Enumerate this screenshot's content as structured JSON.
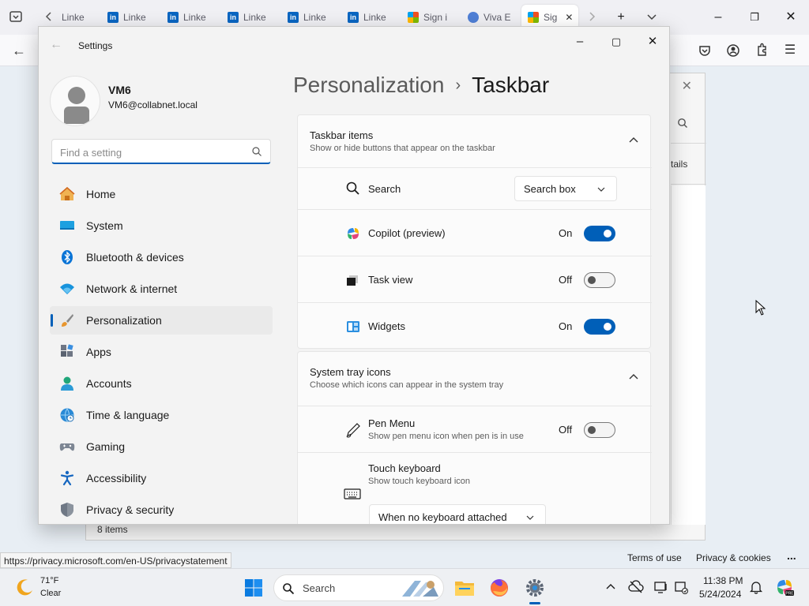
{
  "browser": {
    "tabs": [
      {
        "label": "Linke",
        "favicon": "linkedin-icon"
      },
      {
        "label": "Linke",
        "favicon": "linkedin-icon"
      },
      {
        "label": "Linke",
        "favicon": "linkedin-icon"
      },
      {
        "label": "Linke",
        "favicon": "linkedin-icon"
      },
      {
        "label": "Linke",
        "favicon": "linkedin-icon"
      },
      {
        "label": "Linke",
        "favicon": "linkedin-icon"
      },
      {
        "label": "Sign i",
        "favicon": "microsoft-icon"
      },
      {
        "label": "Viva E",
        "favicon": "viva-icon"
      },
      {
        "label": "Sig",
        "favicon": "microsoft-icon",
        "active": true
      }
    ],
    "status_url": "https://privacy.microsoft.com/en-US/privacystatement",
    "footer_links": [
      "Terms of use",
      "Privacy & cookies",
      "..."
    ],
    "background_dialog": {
      "details_text": "tails",
      "items_count": "8 items"
    }
  },
  "settings": {
    "app_title": "Settings",
    "user": {
      "name": "VM6",
      "email": "VM6@collabnet.local"
    },
    "search": {
      "placeholder": "Find a setting",
      "value": ""
    },
    "nav": [
      {
        "label": "Home",
        "icon": "home-icon"
      },
      {
        "label": "System",
        "icon": "system-icon"
      },
      {
        "label": "Bluetooth & devices",
        "icon": "bluetooth-icon"
      },
      {
        "label": "Network & internet",
        "icon": "wifi-icon"
      },
      {
        "label": "Personalization",
        "icon": "brush-icon",
        "selected": true
      },
      {
        "label": "Apps",
        "icon": "apps-icon"
      },
      {
        "label": "Accounts",
        "icon": "accounts-icon"
      },
      {
        "label": "Time & language",
        "icon": "globe-clock-icon"
      },
      {
        "label": "Gaming",
        "icon": "gamepad-icon"
      },
      {
        "label": "Accessibility",
        "icon": "accessibility-icon"
      },
      {
        "label": "Privacy & security",
        "icon": "shield-icon"
      }
    ],
    "breadcrumb": {
      "parent": "Personalization",
      "separator": "›",
      "current": "Taskbar"
    },
    "taskbar_items": {
      "title": "Taskbar items",
      "subtitle": "Show or hide buttons that appear on the taskbar",
      "search": {
        "label": "Search",
        "dropdown_value": "Search box"
      },
      "copilot": {
        "label": "Copilot (preview)",
        "state": "On",
        "on": true
      },
      "task_view": {
        "label": "Task view",
        "state": "Off",
        "on": false
      },
      "widgets": {
        "label": "Widgets",
        "state": "On",
        "on": true
      }
    },
    "system_tray": {
      "title": "System tray icons",
      "subtitle": "Choose which icons can appear in the system tray",
      "pen_menu": {
        "label": "Pen Menu",
        "sub": "Show pen menu icon when pen is in use",
        "state": "Off",
        "on": false
      },
      "touch_keyboard": {
        "label": "Touch keyboard",
        "sub": "Show touch keyboard icon",
        "dropdown_value": "When no keyboard attached"
      }
    }
  },
  "taskbar": {
    "weather": {
      "temp": "71°F",
      "condition": "Clear"
    },
    "search_label": "Search",
    "clock": {
      "time": "11:38 PM",
      "date": "5/24/2024"
    }
  },
  "colors": {
    "accent": "#005fb8",
    "window_bg": "#f3f3f3",
    "card_bg": "#fbfbfb"
  }
}
